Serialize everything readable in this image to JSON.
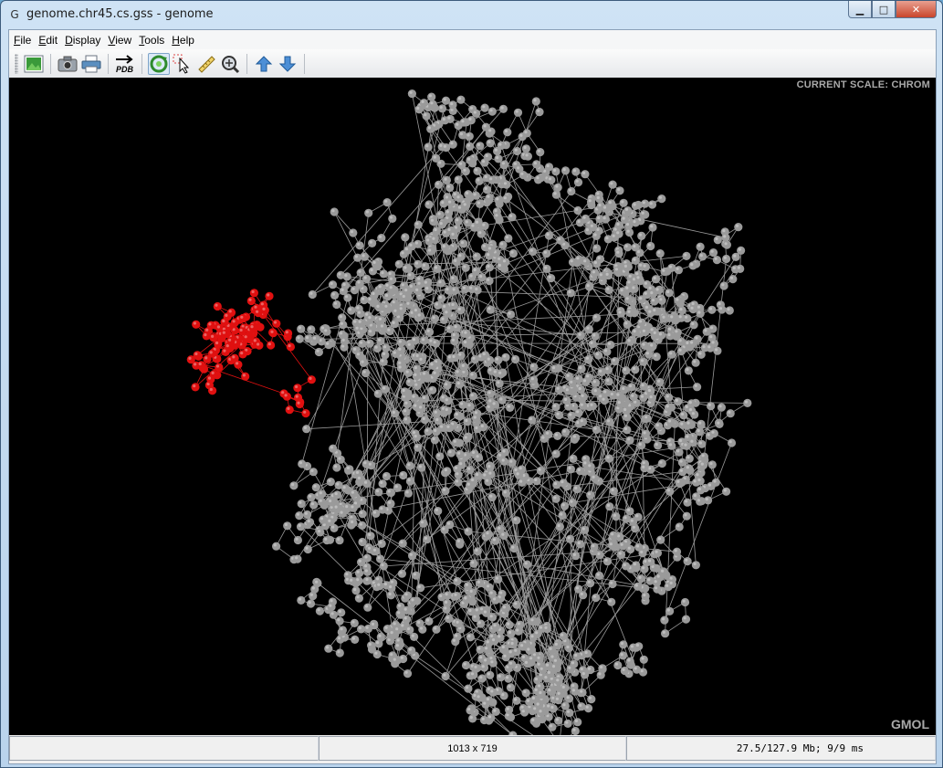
{
  "window": {
    "title": "genome.chr45.cs.gss - genome",
    "app_icon": "G",
    "controls": {
      "minimize": "▁",
      "maximize": "□",
      "close": "✕"
    }
  },
  "menu": [
    {
      "label": "File",
      "mnemonic": "F",
      "rest": "ile"
    },
    {
      "label": "Edit",
      "mnemonic": "E",
      "rest": "dit"
    },
    {
      "label": "Display",
      "mnemonic": "D",
      "rest": "isplay"
    },
    {
      "label": "View",
      "mnemonic": "V",
      "rest": "iew"
    },
    {
      "label": "Tools",
      "mnemonic": "T",
      "rest": "ools"
    },
    {
      "label": "Help",
      "mnemonic": "H",
      "rest": "elp"
    }
  ],
  "toolbar": {
    "pdb_label": "PDB",
    "buttons": [
      "open-image-icon",
      "camera-icon",
      "printer-icon",
      "export-pdb-icon",
      "rotate-icon",
      "select-pointer-icon",
      "ruler-icon",
      "zoom-icon",
      "up-arrow-icon",
      "down-arrow-icon"
    ],
    "active": "rotate-icon"
  },
  "viewport": {
    "scale_label": "CURRENT SCALE: CHROM",
    "watermark": "GMOL",
    "background": "#000000",
    "node_color": "#9a9a9a",
    "highlight_color": "#e01010"
  },
  "status": {
    "left": "",
    "dimensions": "1013 x 719",
    "stats": "27.5/127.9 Mb;   9/9 ms"
  }
}
